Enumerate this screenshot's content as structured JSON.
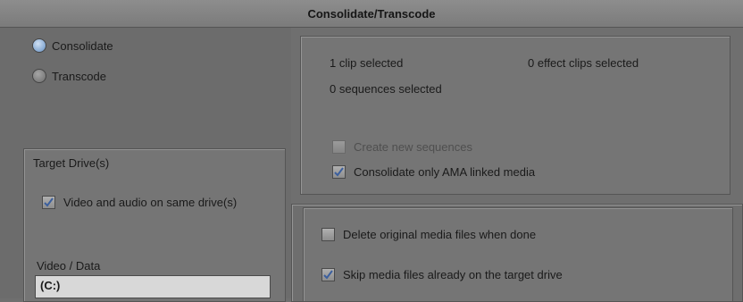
{
  "window": {
    "title": "Consolidate/Transcode"
  },
  "mode": {
    "options": [
      {
        "label": "Consolidate",
        "selected": true
      },
      {
        "label": "Transcode",
        "selected": false
      }
    ]
  },
  "selection_info": {
    "clips": "1 clip selected",
    "effect_clips": "0 effect clips selected",
    "sequences": "0 sequences selected"
  },
  "options_top": {
    "create_new_sequences": {
      "label": "Create new sequences",
      "checked": false,
      "enabled": false
    },
    "consolidate_ama": {
      "label": "Consolidate only AMA linked media",
      "checked": true,
      "enabled": true
    }
  },
  "target": {
    "heading": "Target Drive(s)",
    "same_drive": {
      "label": "Video and audio on same drive(s)",
      "checked": true
    },
    "video_data_label": "Video / Data",
    "video_data_value": "(C:)"
  },
  "options_bottom": {
    "delete_original": {
      "label": "Delete original media files when done",
      "checked": false
    },
    "skip_existing": {
      "label": "Skip media files already on the target drive",
      "checked": true
    }
  },
  "colors": {
    "selected_radio": "#8fb0d6",
    "check": "#3b5f9e"
  },
  "icons": {
    "checkmark": "checkmark-icon",
    "radio": "radio-dot-icon"
  }
}
